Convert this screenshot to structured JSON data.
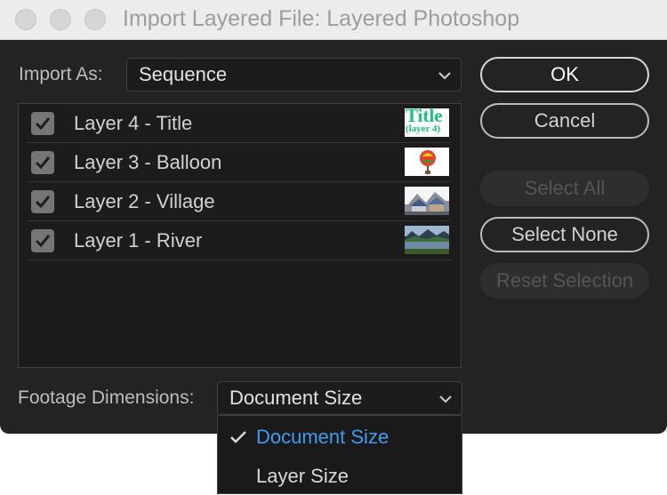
{
  "window": {
    "title": "Import Layered File: Layered Photoshop"
  },
  "import_as": {
    "label": "Import As:",
    "value": "Sequence"
  },
  "layers": [
    {
      "label": "Layer 4 - Title",
      "checked": true,
      "thumbnail": "title-text-thumbnail",
      "thumb_text_1": "Title",
      "thumb_text_2": "(layer 4)"
    },
    {
      "label": "Layer 3 - Balloon",
      "checked": true,
      "thumbnail": "balloon-thumbnail"
    },
    {
      "label": "Layer 2 - Village",
      "checked": true,
      "thumbnail": "village-thumbnail"
    },
    {
      "label": "Layer 1 - River",
      "checked": true,
      "thumbnail": "river-thumbnail"
    }
  ],
  "buttons": {
    "ok": "OK",
    "cancel": "Cancel",
    "select_all": "Select All",
    "select_none": "Select None",
    "reset_selection": "Reset Selection"
  },
  "footage_dimensions": {
    "label": "Footage Dimensions:",
    "value": "Document Size",
    "options": [
      {
        "label": "Document Size",
        "selected": true
      },
      {
        "label": "Layer Size",
        "selected": false
      }
    ]
  },
  "colors": {
    "dialog_bg": "#232323",
    "titlebar_bg": "#ececec",
    "selected_accent": "#3d9ef0",
    "thumb_title_green": "#16c47a"
  }
}
